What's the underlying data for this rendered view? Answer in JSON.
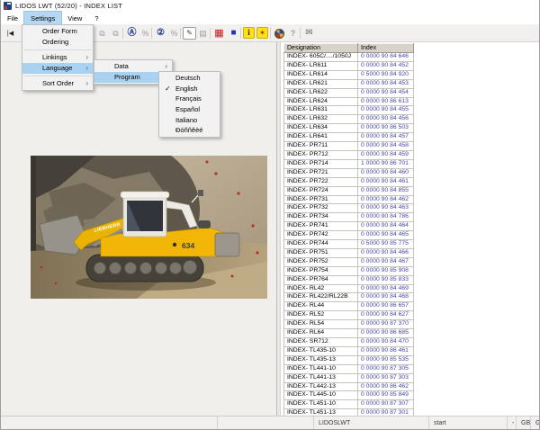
{
  "window": {
    "title": "LIDOS LWT (52/20) - INDEX LIST"
  },
  "menubar": {
    "items": [
      "File",
      "Settings",
      "View",
      "?"
    ]
  },
  "settings_menu": {
    "order_form": "Order Form",
    "ordering": "Ordering",
    "linkings": "Linkings",
    "language": "Language",
    "sort_order": "Sort Order"
  },
  "language_menu": {
    "data_label": "Data",
    "program_label": "Program"
  },
  "program_menu": {
    "languages": [
      "Deutsch",
      "English",
      "Français",
      "Español",
      "Italiano",
      "Ðóññêèé"
    ],
    "checked": "English"
  },
  "glyphs": {
    "submenu_arrow": "›",
    "check": "✓"
  },
  "toolbar": {
    "buttons": [
      {
        "name": "nav-first",
        "glyph": "|◀"
      },
      {
        "name": "window-cascade",
        "glyph": "⧉"
      },
      {
        "name": "window-tile",
        "glyph": "⧉"
      },
      {
        "name": "circled-a",
        "glyph": "Ⓐ"
      },
      {
        "name": "scale-a",
        "glyph": "%"
      },
      {
        "name": "circled-2",
        "glyph": "②"
      },
      {
        "name": "scale-2",
        "glyph": "%"
      },
      {
        "name": "edit-note",
        "glyph": "✎"
      },
      {
        "name": "print",
        "glyph": "▤"
      },
      {
        "name": "grid-red",
        "glyph": "▦"
      },
      {
        "name": "square-blue",
        "glyph": "■"
      },
      {
        "name": "info-yellow",
        "glyph": "i"
      },
      {
        "name": "key-yellow",
        "glyph": "✶"
      },
      {
        "name": "globe",
        "glyph": ""
      },
      {
        "name": "help",
        "glyph": "?"
      },
      {
        "name": "mail",
        "glyph": "✉"
      }
    ]
  },
  "photo": {
    "brand": "LIEBHERR",
    "model": "634"
  },
  "table": {
    "headers": [
      "Designation",
      "Index"
    ],
    "rows": [
      [
        "INDEX- 605C/..../1050J",
        "0 0000 90 84 646"
      ],
      [
        "INDEX- LR611",
        "0 0000 90 84 452"
      ],
      [
        "INDEX- LR614",
        "0 5000 90 84 920"
      ],
      [
        "INDEX- LR621",
        "0 0000 90 84 453"
      ],
      [
        "INDEX- LR622",
        "0 0000 90 84 454"
      ],
      [
        "INDEX- LR624",
        "0 0000 90 86 613"
      ],
      [
        "INDEX- LR631",
        "0 0000 90 84 455"
      ],
      [
        "INDEX- LR632",
        "0 0000 90 84 456"
      ],
      [
        "INDEX- LR634",
        "0 0000 90 86 503"
      ],
      [
        "INDEX- LR641",
        "0 0000 90 84 457"
      ],
      [
        "INDEX- PR711",
        "0 0000 90 84 458"
      ],
      [
        "INDEX- PR712",
        "0 0000 90 84 459"
      ],
      [
        "INDEX- PR714",
        "1 0000 90 86 701"
      ],
      [
        "INDEX- PR721",
        "0 0000 90 84 460"
      ],
      [
        "INDEX- PR722",
        "0 0000 90 84 461"
      ],
      [
        "INDEX- PR724",
        "0 0000 90 84 855"
      ],
      [
        "INDEX- PR731",
        "0 0000 90 84 462"
      ],
      [
        "INDEX- PR732",
        "0 0000 90 84 463"
      ],
      [
        "INDEX- PR734",
        "0 0000 90 84 786"
      ],
      [
        "INDEX- PR741",
        "0 0000 90 84 464"
      ],
      [
        "INDEX- PR742",
        "0 0000 90 84 465"
      ],
      [
        "INDEX- PR744",
        "0 5000 90 85 775"
      ],
      [
        "INDEX- PR751",
        "0 0000 90 84 466"
      ],
      [
        "INDEX- PR752",
        "0 0000 90 84 467"
      ],
      [
        "INDEX- PR754",
        "0 0000 90 85 908"
      ],
      [
        "INDEX- PR764",
        "0 0000 90 85 833"
      ],
      [
        "INDEX- RL42",
        "0 0000 90 84 469"
      ],
      [
        "INDEX- RL422/RL22B",
        "0 0000 90 84 468"
      ],
      [
        "INDEX- RL44",
        "0 0000 90 86 657"
      ],
      [
        "INDEX- RL52",
        "0 0000 90 84 627"
      ],
      [
        "INDEX- RL54",
        "0 0000 90 87 370"
      ],
      [
        "INDEX- RL64",
        "0 0000 90 86 685"
      ],
      [
        "INDEX- SR712",
        "0 0000 90 84 470"
      ],
      [
        "INDEX- TL435-10",
        "0 0000 90 86 461"
      ],
      [
        "INDEX- TL435-13",
        "0 0000 90 85 535"
      ],
      [
        "INDEX- TL441-10",
        "0 0000 90 87 305"
      ],
      [
        "INDEX- TL441-13",
        "0 0000 90 87 303"
      ],
      [
        "INDEX- TL442-13",
        "0 0000 90 86 462"
      ],
      [
        "INDEX- TL445-10",
        "0 0000 90 85 849"
      ],
      [
        "INDEX- TL451-10",
        "0 0000 90 87 307"
      ],
      [
        "INDEX- TL451-13",
        "0 0000 90 87 301"
      ]
    ]
  },
  "statusbar": {
    "app": "LIDOSLWT",
    "action": "start",
    "dash": "-",
    "lang_left": "GB",
    "lang_right": "GB"
  },
  "colors": {
    "menu_highlight": "#a9d2f0",
    "index_text": "#4747ab",
    "toolbar_red": "#c41414",
    "toolbar_blue": "#2335b4",
    "toolbar_yellow": "#ffe216"
  }
}
